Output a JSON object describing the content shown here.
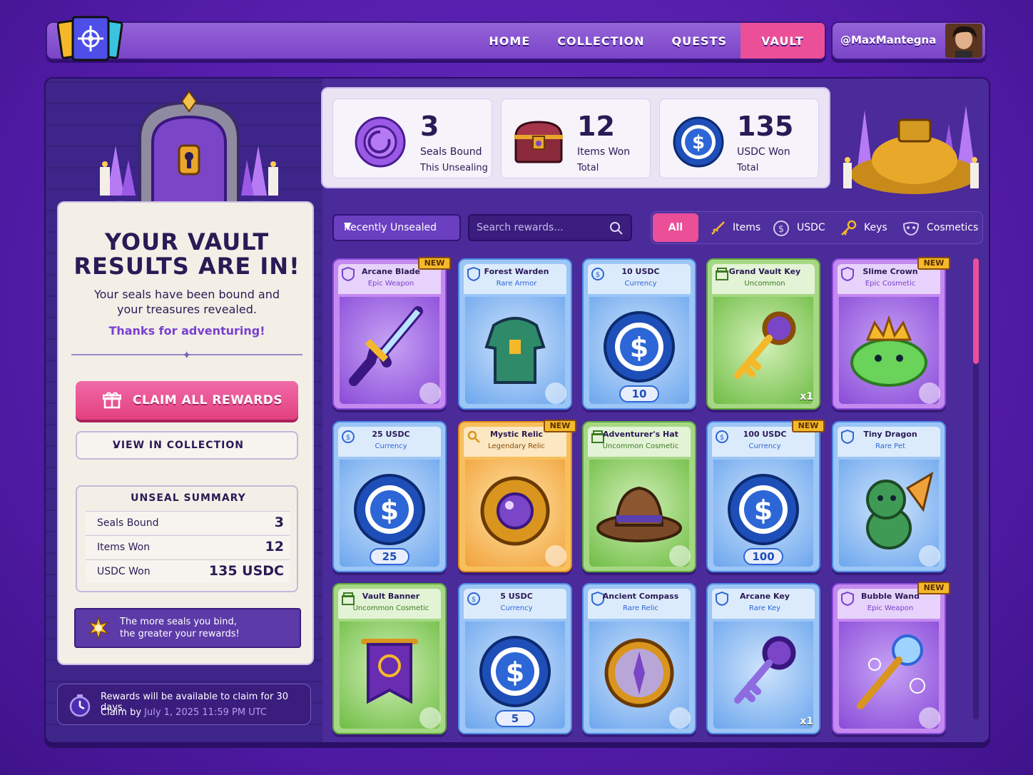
{
  "nav": {
    "links": [
      "HOME",
      "COLLECTION",
      "QUESTS",
      "VAULT"
    ],
    "active": "VAULT",
    "username": "@MaxMantegna"
  },
  "stats": [
    {
      "value": "3",
      "label": "Seals Bound",
      "sub": "This Unsealing",
      "icon": "seal-icon"
    },
    {
      "value": "12",
      "label": "Items Won",
      "sub": "Total",
      "icon": "treasure-chest-icon"
    },
    {
      "value": "135",
      "label": "USDC Won",
      "sub": "Total",
      "icon": "usdc-coin-icon"
    }
  ],
  "panel": {
    "heading_line1": "YOUR VAULT",
    "heading_line2": "RESULTS ARE IN!",
    "text_line1": "Your seals have been bound and",
    "text_line2": "your treasures revealed.",
    "thanks": "Thanks for adventuring!",
    "claim_label": "CLAIM ALL REWARDS",
    "view_label": "VIEW IN COLLECTION",
    "summary": {
      "title": "UNSEAL SUMMARY",
      "rows": [
        {
          "key": "Seals Bound",
          "value": "3"
        },
        {
          "key": "Items Won",
          "value": "12"
        },
        {
          "key": "USDC Won",
          "value": "135 USDC"
        }
      ]
    },
    "banner_line1": "The more seals you bind,",
    "banner_line2": "the greater your rewards!"
  },
  "note": {
    "line1": "Rewards will be available to claim for 30 days.",
    "line2_prefix": "Claim by ",
    "line2_date": "July 1, 2025 11:59 PM UTC"
  },
  "filters": {
    "dropdown": "Recently Unsealed",
    "search_placeholder": "Search rewards...",
    "tabs": [
      "All",
      "Items",
      "USDC",
      "Keys",
      "Cosmetics"
    ],
    "active_tab": "All"
  },
  "cards": [
    {
      "name": "Arcane Blade",
      "rarity": "Epic Weapon",
      "color": "purple",
      "new": true,
      "art": "sword-icon"
    },
    {
      "name": "Forest Warden",
      "rarity": "Rare Armor",
      "color": "blue",
      "new": false,
      "art": "armor-icon"
    },
    {
      "name": "10 USDC",
      "rarity": "Currency",
      "color": "blue",
      "new": false,
      "art": "usdc-coin-icon",
      "value": "10"
    },
    {
      "name": "Grand Vault Key",
      "rarity": "Uncommon",
      "color": "green",
      "new": false,
      "art": "gold-key-icon",
      "mult": "x1"
    },
    {
      "name": "Slime Crown",
      "rarity": "Epic Cosmetic",
      "color": "purple",
      "new": true,
      "art": "slime-icon"
    },
    {
      "name": "25 USDC",
      "rarity": "Currency",
      "color": "blue",
      "new": false,
      "art": "usdc-coin-icon",
      "value": "25"
    },
    {
      "name": "Mystic Relic",
      "rarity": "Legendary Relic",
      "color": "orange",
      "new": true,
      "art": "relic-icon"
    },
    {
      "name": "Adventurer's Hat",
      "rarity": "Uncommon Cosmetic",
      "color": "green",
      "new": false,
      "art": "hat-icon"
    },
    {
      "name": "100 USDC",
      "rarity": "Currency",
      "color": "blue",
      "new": true,
      "art": "usdc-coin-icon",
      "value": "100"
    },
    {
      "name": "Tiny Dragon",
      "rarity": "Rare Pet",
      "color": "blue",
      "new": false,
      "art": "dragon-icon"
    },
    {
      "name": "Vault Banner",
      "rarity": "Uncommon Cosmetic",
      "color": "green",
      "new": false,
      "art": "banner-icon"
    },
    {
      "name": "5 USDC",
      "rarity": "Currency",
      "color": "blue",
      "new": false,
      "art": "usdc-coin-icon",
      "value": "5"
    },
    {
      "name": "Ancient Compass",
      "rarity": "Rare Relic",
      "color": "blue",
      "new": false,
      "art": "compass-icon"
    },
    {
      "name": "Arcane Key",
      "rarity": "Rare Key",
      "color": "blue",
      "new": false,
      "art": "arcane-key-icon",
      "mult": "x1"
    },
    {
      "name": "Bubble Wand",
      "rarity": "Epic Weapon",
      "color": "purple",
      "new": true,
      "art": "wand-icon"
    }
  ],
  "new_label": "NEW",
  "colors": {
    "accent": "#ea4f98",
    "primary": "#5a1fb0",
    "usdc": "#1e4fb8"
  }
}
